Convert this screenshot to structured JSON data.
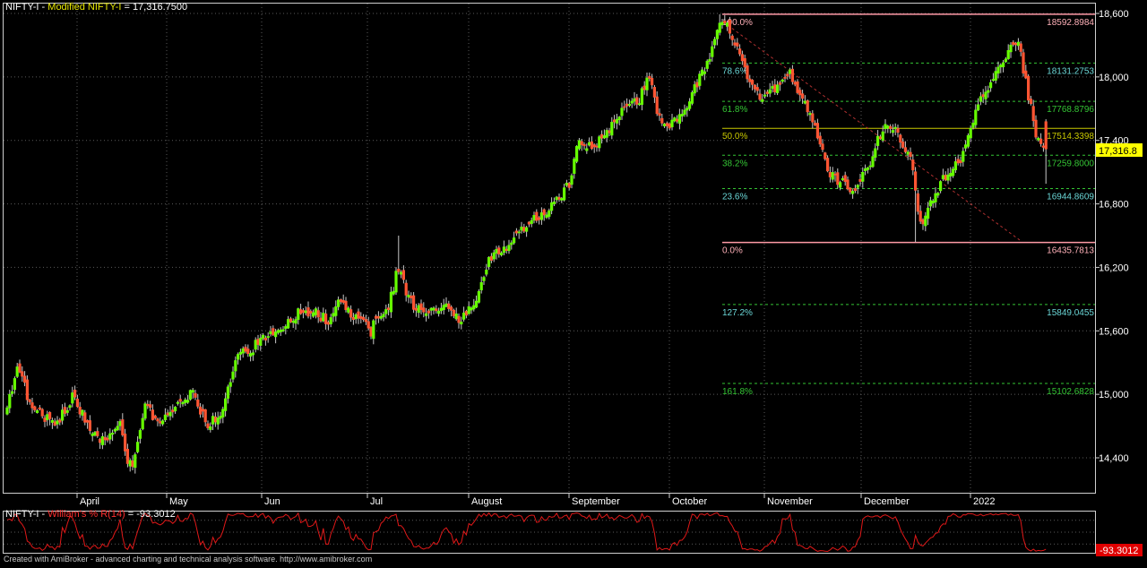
{
  "header": {
    "symbol": "NIFTY-I",
    "separator": " - ",
    "study": "Modified NIFTY-I",
    "value": " = 17,316.7500"
  },
  "subheader": {
    "symbol": "NIFTY-I",
    "separator": " - ",
    "study": "William's % R(14)",
    "value": " = -93.3012"
  },
  "price_badge": "17,316.8",
  "wr_badge": "-93.3012",
  "footer": "Created with AmiBroker - advanced charting and technical analysis software. http://www.amibroker.com",
  "colors": {
    "background": "#000000",
    "bull": "#66ff00",
    "bear": "#ff5533",
    "grid": "#5a5a5a",
    "fib_line": "#34c434",
    "fib_level": "#c8c800",
    "fib_bound": "#ff9aa6",
    "trend": "#b03030",
    "wr_line": "#e01818",
    "price_badge_bg": "#ffff00",
    "wr_badge_bg": "#e00000",
    "axis_text": "#ffffff"
  },
  "chart_data": [
    {
      "type": "candlestick",
      "title": "Modified NIFTY-I",
      "y_ticks": [
        14400,
        15000,
        15600,
        16200,
        16800,
        17400,
        18000,
        18600
      ],
      "y_tick_labels": [
        "14,400",
        "15,000",
        "15,600",
        "16,200",
        "16,800",
        "17,400",
        "18,000",
        "18,600"
      ],
      "ylim": [
        14100,
        18650
      ],
      "x_month_labels": [
        "April",
        "May",
        "Jun",
        "Jul",
        "August",
        "September",
        "October",
        "November",
        "December",
        "2022"
      ],
      "grid": true,
      "last_close": 17316.75,
      "anchor_closes": [
        [
          0,
          14850
        ],
        [
          4,
          15300
        ],
        [
          9,
          14900
        ],
        [
          14,
          14800
        ],
        [
          20,
          14700
        ],
        [
          26,
          15000
        ],
        [
          30,
          14800
        ],
        [
          33,
          14650
        ],
        [
          38,
          14550
        ],
        [
          45,
          14700
        ],
        [
          48,
          14350
        ],
        [
          50,
          14300
        ],
        [
          55,
          14950
        ],
        [
          60,
          14700
        ],
        [
          65,
          14850
        ],
        [
          70,
          14950
        ],
        [
          74,
          15000
        ],
        [
          80,
          14700
        ],
        [
          86,
          14850
        ],
        [
          92,
          15400
        ],
        [
          98,
          15450
        ],
        [
          105,
          15550
        ],
        [
          112,
          15700
        ],
        [
          118,
          15800
        ],
        [
          124,
          15750
        ],
        [
          128,
          15700
        ],
        [
          132,
          15850
        ],
        [
          136,
          15800
        ],
        [
          140,
          15700
        ],
        [
          145,
          15600
        ],
        [
          148,
          15750
        ],
        [
          152,
          15850
        ],
        [
          156,
          16200
        ],
        [
          160,
          15900
        ],
        [
          164,
          15800
        ],
        [
          168,
          15750
        ],
        [
          172,
          15800
        ],
        [
          176,
          15850
        ],
        [
          180,
          15700
        ],
        [
          184,
          15800
        ],
        [
          188,
          15950
        ],
        [
          192,
          16300
        ],
        [
          196,
          16350
        ],
        [
          202,
          16450
        ],
        [
          208,
          16650
        ],
        [
          212,
          16700
        ],
        [
          216,
          16750
        ],
        [
          220,
          16850
        ],
        [
          224,
          17000
        ],
        [
          228,
          17400
        ],
        [
          234,
          17350
        ],
        [
          240,
          17500
        ],
        [
          246,
          17700
        ],
        [
          252,
          17800
        ],
        [
          256,
          18000
        ],
        [
          260,
          17600
        ],
        [
          264,
          17550
        ],
        [
          270,
          17700
        ],
        [
          276,
          18000
        ],
        [
          280,
          18150
        ],
        [
          284,
          18500
        ],
        [
          288,
          18450
        ],
        [
          292,
          18200
        ],
        [
          296,
          17900
        ],
        [
          300,
          17800
        ],
        [
          304,
          17850
        ],
        [
          308,
          17950
        ],
        [
          312,
          18050
        ],
        [
          316,
          17800
        ],
        [
          320,
          17650
        ],
        [
          324,
          17350
        ],
        [
          328,
          17100
        ],
        [
          332,
          17000
        ],
        [
          336,
          16950
        ],
        [
          340,
          17000
        ],
        [
          344,
          17200
        ],
        [
          348,
          17450
        ],
        [
          352,
          17550
        ],
        [
          356,
          17400
        ],
        [
          360,
          17200
        ],
        [
          362,
          16950
        ],
        [
          364,
          16600
        ],
        [
          368,
          16800
        ],
        [
          372,
          17000
        ],
        [
          376,
          17100
        ],
        [
          380,
          17200
        ],
        [
          384,
          17500
        ],
        [
          388,
          17800
        ],
        [
          392,
          17950
        ],
        [
          396,
          18150
        ],
        [
          400,
          18300
        ],
        [
          403,
          18350
        ],
        [
          406,
          17950
        ],
        [
          410,
          17450
        ],
        [
          414,
          17316.75
        ]
      ],
      "fibonacci": {
        "high": 18592.8984,
        "low": 16435.7813,
        "levels": [
          {
            "ratio": "100.0%",
            "value": 18592.8984,
            "label": "18592.8984"
          },
          {
            "ratio": "78.6%",
            "value": 18131.2753,
            "label": "18131.2753"
          },
          {
            "ratio": "61.8%",
            "value": 17768.8796,
            "label": "17768.8796"
          },
          {
            "ratio": "50.0%",
            "value": 17514.3398,
            "label": "17514.3398"
          },
          {
            "ratio": "38.2%",
            "value": 17259.8,
            "label": "17259.8000"
          },
          {
            "ratio": "23.6%",
            "value": 16944.8609,
            "label": "16944.8609"
          },
          {
            "ratio": "0.0%",
            "value": 16435.7813,
            "label": "16435.7813"
          },
          {
            "ratio": "127.2%",
            "value": 15849.0455,
            "label": "15849.0455"
          },
          {
            "ratio": "161.8%",
            "value": 15102.6828,
            "label": "15102.6828"
          }
        ]
      }
    },
    {
      "type": "line",
      "title": "William's % R(14)",
      "ylim": [
        -100,
        0
      ],
      "last_value": -93.3012
    }
  ]
}
